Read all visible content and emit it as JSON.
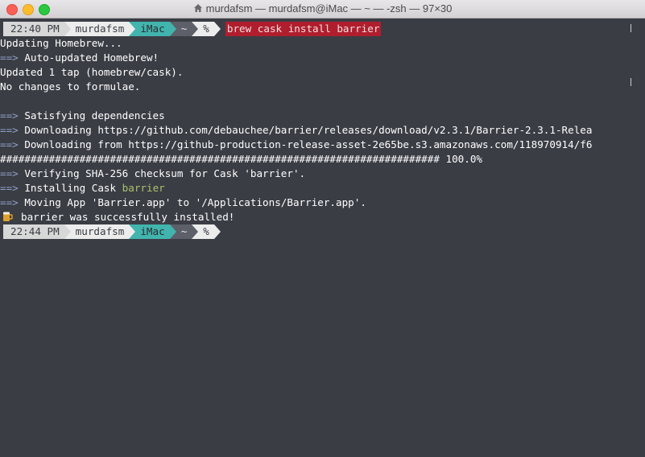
{
  "window": {
    "title": "murdafsm — murdafsm@iMac — ~ — -zsh — 97×30"
  },
  "prompts": [
    {
      "time": "22:40 PM",
      "user": "murdafsm",
      "host": "iMac",
      "dir": "~",
      "symbol": "%",
      "command": "brew cask install barrier"
    },
    {
      "time": "22:44 PM",
      "user": "murdafsm",
      "host": "iMac",
      "dir": "~",
      "symbol": "%",
      "command": ""
    }
  ],
  "output": {
    "l1": "Updating Homebrew...",
    "l2_arrow": "==>",
    "l2": " Auto-updated Homebrew!",
    "l3": "Updated 1 tap (homebrew/cask).",
    "l4": "No changes to formulae.",
    "l6_arrow": "==>",
    "l6": " Satisfying dependencies",
    "l7_arrow": "==>",
    "l7": " Downloading https://github.com/debauchee/barrier/releases/download/v2.3.1/Barrier-2.3.1-Relea",
    "l8_arrow": "==>",
    "l8": " Downloading from https://github-production-release-asset-2e65be.s3.amazonaws.com/118970914/f6",
    "l9": "######################################################################## 100.0%",
    "l10_arrow": "==>",
    "l10": " Verifying SHA-256 checksum for Cask 'barrier'.",
    "l11_arrow": "==>",
    "l11": " Installing Cask ",
    "l11_name": "barrier",
    "l12_arrow": "==>",
    "l12": " Moving App 'Barrier.app' to '/Applications/Barrier.app'.",
    "l13": "barrier was successfully installed!"
  },
  "icons": {
    "title": "home-icon",
    "success": "beer-icon"
  },
  "colors": {
    "background": "#3b3d45",
    "arrow": "#8da0c7",
    "command_highlight": "#b01e2e",
    "host_segment": "#41b4ad",
    "cask_name": "#a9c26a"
  }
}
